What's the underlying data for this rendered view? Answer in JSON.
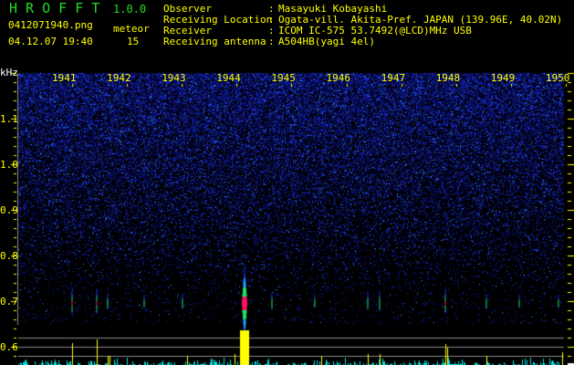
{
  "app": {
    "title": "H R O F F T",
    "version": "1.0.0"
  },
  "file": {
    "name": "0412071940.png",
    "datetime": "04.12.07 19:40"
  },
  "meteor": {
    "label": "meteor",
    "count": "15"
  },
  "info": [
    {
      "label": "Observer",
      "value": "Masayuki Kobayashi"
    },
    {
      "label": "Receiving Location",
      "value": "Ogata-vill. Akita-Pref. JAPAN (139.96E, 40.02N)"
    },
    {
      "label": "Receiver",
      "value": "ICOM IC-575 53.7492(@LCD)MHz USB"
    },
    {
      "label": "Receiving antenna",
      "value": "A504HB(yagi 4el)"
    }
  ],
  "axis": {
    "unit": "kHz",
    "freq_ticks": [
      "1.1",
      "1.0",
      "0.9",
      "0.8",
      "0.7",
      "0.6"
    ],
    "time_ticks": [
      "1941",
      "1942",
      "1943",
      "1944",
      "1945",
      "1946",
      "1947",
      "1948",
      "1949",
      "1950"
    ]
  },
  "colors": {
    "text": "#ffff00",
    "title": "#22dd22",
    "noise": "#1020c0",
    "echo_peak": "#ff1060",
    "bar_strong": "#ffff00",
    "bar_weak": "#00e0e0"
  }
}
